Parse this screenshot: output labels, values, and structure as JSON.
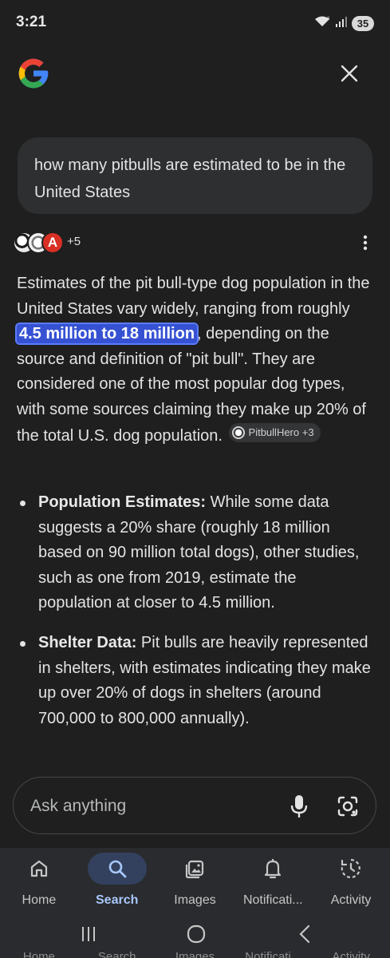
{
  "status_bar": {
    "time": "3:21",
    "wifi_label": "6",
    "battery": "35"
  },
  "header": {
    "logo_icon": "google-g-logo",
    "close_icon": "close-icon"
  },
  "query": {
    "text": "how many pitbulls are estimated to be in the United States"
  },
  "sources": {
    "extra_count": "+5"
  },
  "answer": {
    "intro_before": "Estimates of the pit bull-type dog population in the United States vary widely, ranging from roughly ",
    "highlight": "4.5 million to 18 million",
    "intro_after": ", depending on the source and definition of \"pit bull\". They are considered one of the most popular dog types, with some sources claiming they make up 20% of the total U.S. dog population.",
    "citation_chip": "PitbullHero +3"
  },
  "bullets": [
    {
      "title": "Population Estimates:",
      "text": " While some data suggests a 20% share (roughly 18 million based on 90 million total dogs), other studies, such as one from 2019, estimate the population at closer to 4.5 million."
    },
    {
      "title": "Shelter Data:",
      "text": " Pit bulls are heavily represented in shelters, with estimates indicating they make up over 20% of dogs in shelters (around 700,000 to 800,000 annually)."
    }
  ],
  "ask_bar": {
    "placeholder": "Ask anything",
    "mic_icon": "mic-icon",
    "lens_icon": "lens-camera-icon"
  },
  "bottom_nav": {
    "items": [
      {
        "label": "Home",
        "icon": "home-icon"
      },
      {
        "label": "Search",
        "icon": "search-icon"
      },
      {
        "label": "Images",
        "icon": "images-icon"
      },
      {
        "label": "Notificati...",
        "icon": "bell-icon"
      },
      {
        "label": "Activity",
        "icon": "activity-icon"
      }
    ],
    "active": "Search"
  },
  "ghost_nav": [
    "Home",
    "Search",
    "Images",
    "Notificati...",
    "Activity"
  ],
  "colors": {
    "background": "#1f1f1f",
    "highlight": "#3652d3",
    "active_nav": "#a8c7fa"
  }
}
